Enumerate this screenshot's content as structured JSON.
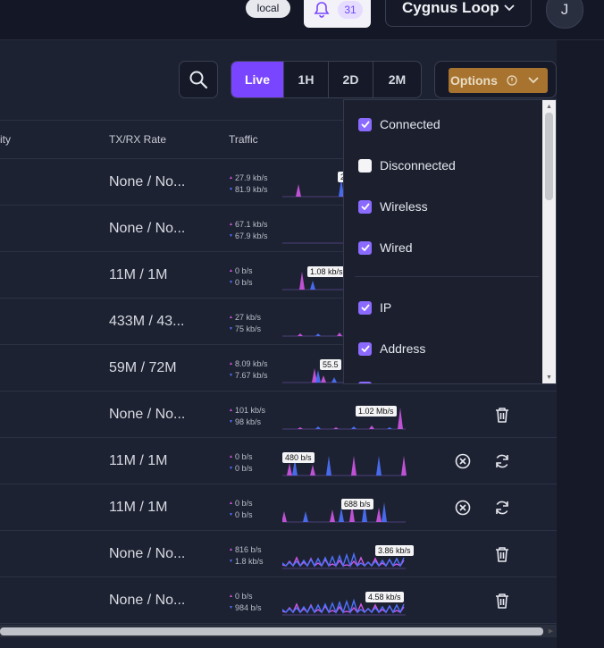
{
  "topbar": {
    "env_badge": "local",
    "notification_count": "31",
    "network_name": "Cygnus Loop",
    "user_initial": "J"
  },
  "toolbar": {
    "time_tabs": [
      "Live",
      "1H",
      "2D",
      "2M"
    ],
    "active_tab": "Live",
    "options_label": "Options"
  },
  "table": {
    "headers": {
      "partial_left": "ity",
      "rate": "TX/RX Rate",
      "traffic": "Traffic"
    },
    "rows": [
      {
        "rate": "None / No...",
        "up": "27.9 kb/s",
        "down": "81.9 kb/s",
        "peak": "2",
        "actions": []
      },
      {
        "rate": "None / No...",
        "up": "67.1 kb/s",
        "down": "67.9 kb/s",
        "peak": "",
        "actions": []
      },
      {
        "rate": "11M / 1M",
        "up": "0 b/s",
        "down": "0 b/s",
        "peak": "1.08 kb/s",
        "actions": []
      },
      {
        "rate": "433M / 43...",
        "up": "27 kb/s",
        "down": "75 kb/s",
        "peak": "",
        "actions": []
      },
      {
        "rate": "59M / 72M",
        "up": "8.09 kb/s",
        "down": "7.67 kb/s",
        "peak": "55.5",
        "actions": []
      },
      {
        "rate": "None / No...",
        "up": "101 kb/s",
        "down": "98 kb/s",
        "peak": "1.02 Mb/s",
        "actions": [
          "delete"
        ]
      },
      {
        "rate": "11M / 1M",
        "up": "0 b/s",
        "down": "0 b/s",
        "peak": "480 b/s",
        "actions": [
          "block",
          "refresh"
        ]
      },
      {
        "rate": "11M / 1M",
        "up": "0 b/s",
        "down": "0 b/s",
        "peak": "688 b/s",
        "actions": [
          "block",
          "refresh"
        ]
      },
      {
        "rate": "None / No...",
        "up": "816 b/s",
        "down": "1.8 kb/s",
        "peak": "3.86 kb/s",
        "actions": [
          "delete"
        ]
      },
      {
        "rate": "None / No...",
        "up": "0 b/s",
        "down": "984 b/s",
        "peak": "4.58 kb/s",
        "actions": [
          "delete"
        ]
      }
    ]
  },
  "options_menu": {
    "items": [
      {
        "label": "Connected",
        "checked": true
      },
      {
        "label": "Disconnected",
        "checked": false
      },
      {
        "label": "Wireless",
        "checked": true
      },
      {
        "label": "Wired",
        "checked": true
      },
      {
        "label": "IP",
        "checked": true
      },
      {
        "label": "Address",
        "checked": true
      }
    ]
  },
  "colors": {
    "accent": "#7a45ff",
    "upload": "#d156e6",
    "download": "#4d72ff",
    "options_highlight": "#a8732e"
  }
}
